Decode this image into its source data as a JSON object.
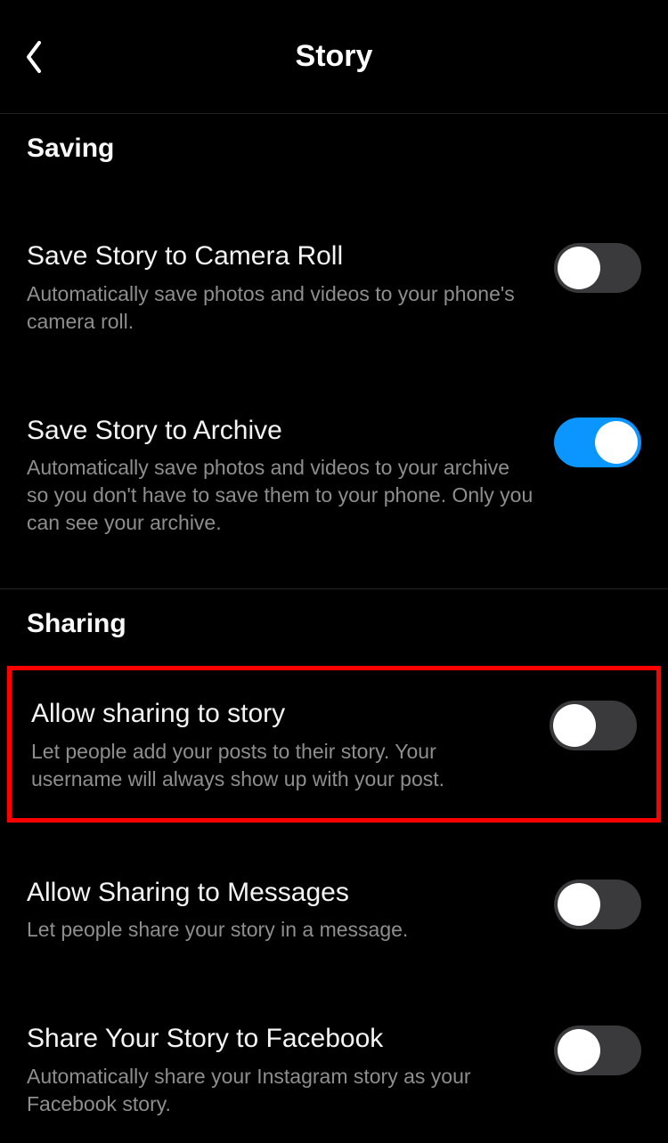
{
  "header": {
    "title": "Story"
  },
  "sections": {
    "saving": {
      "header": "Saving",
      "items": {
        "camera_roll": {
          "title": "Save Story to Camera Roll",
          "desc": "Automatically save photos and videos to your phone's camera roll.",
          "on": false
        },
        "archive": {
          "title": "Save Story to Archive",
          "desc": "Automatically save photos and videos to your archive so you don't have to save them to your phone. Only you can see your archive.",
          "on": true
        }
      }
    },
    "sharing": {
      "header": "Sharing",
      "items": {
        "allow_story": {
          "title": "Allow sharing to story",
          "desc": "Let people add your posts to their story. Your username will always show up with your post.",
          "on": false
        },
        "allow_messages": {
          "title": "Allow Sharing to Messages",
          "desc": "Let people share your story in a message.",
          "on": false
        },
        "facebook": {
          "title": "Share Your Story to Facebook",
          "desc": "Automatically share your Instagram story as your Facebook story.",
          "on": false
        }
      }
    }
  }
}
